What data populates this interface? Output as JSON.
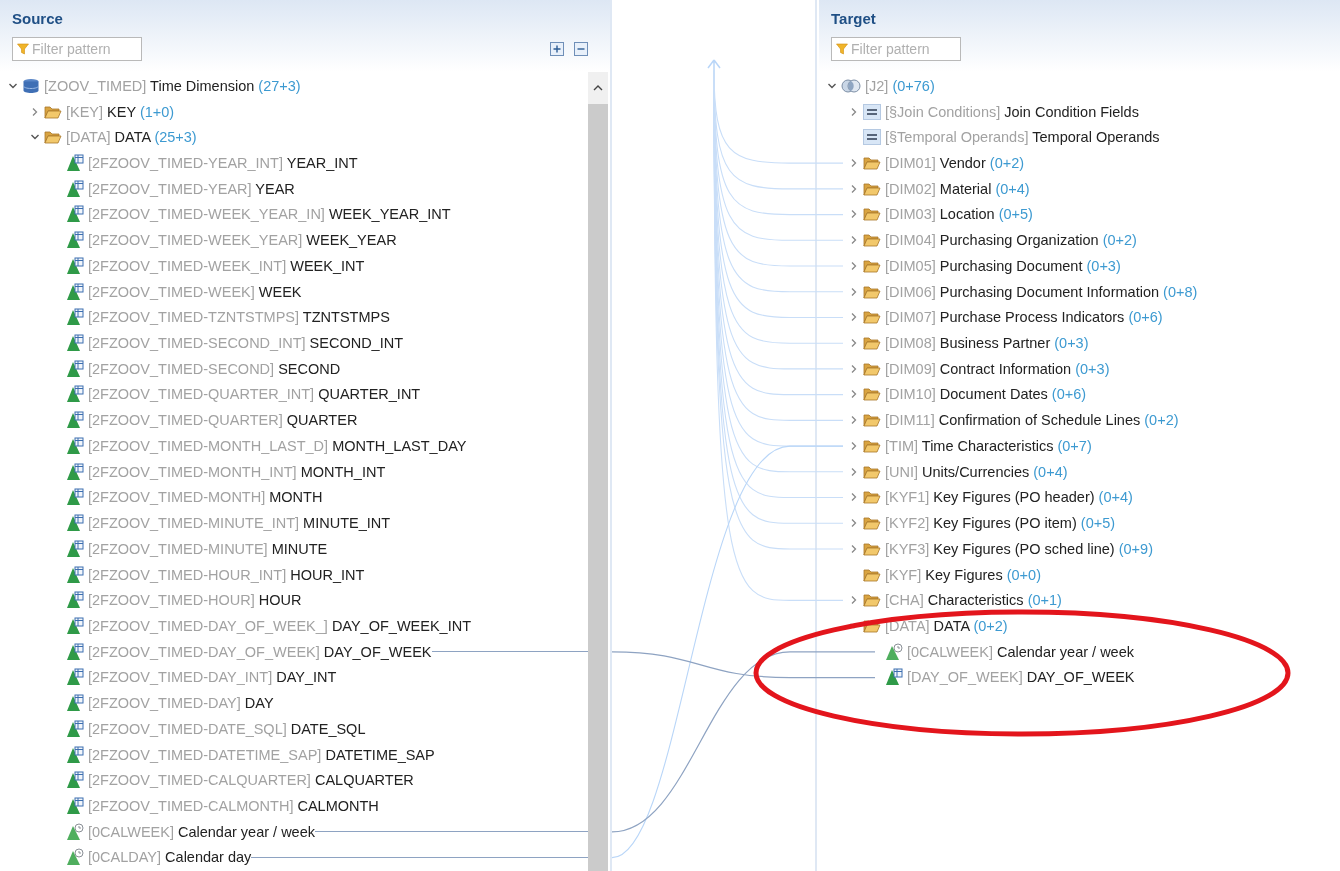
{
  "source": {
    "title": "Source",
    "filter": {
      "placeholder": "Filter pattern"
    },
    "tree": [
      {
        "kind": "table",
        "key": "[ZOOV_TIMED]",
        "name": "Time Dimension",
        "count": "(27+3)",
        "expanded": true,
        "children": [
          {
            "kind": "folder",
            "key": "[KEY]",
            "name": "KEY",
            "count": "(1+0)",
            "expanded": false
          },
          {
            "kind": "folder",
            "key": "[DATA]",
            "name": "DATA",
            "count": "(25+3)",
            "expanded": true,
            "children": [
              {
                "kind": "field",
                "key": "[2FZOOV_TIMED-YEAR_INT]",
                "name": "YEAR_INT",
                "mapped": false
              },
              {
                "kind": "field",
                "key": "[2FZOOV_TIMED-YEAR]",
                "name": "YEAR",
                "mapped": false
              },
              {
                "kind": "field",
                "key": "[2FZOOV_TIMED-WEEK_YEAR_IN]",
                "name": "WEEK_YEAR_INT",
                "mapped": false
              },
              {
                "kind": "field",
                "key": "[2FZOOV_TIMED-WEEK_YEAR]",
                "name": "WEEK_YEAR",
                "mapped": false
              },
              {
                "kind": "field",
                "key": "[2FZOOV_TIMED-WEEK_INT]",
                "name": "WEEK_INT",
                "mapped": false
              },
              {
                "kind": "field",
                "key": "[2FZOOV_TIMED-WEEK]",
                "name": "WEEK",
                "mapped": false
              },
              {
                "kind": "field",
                "key": "[2FZOOV_TIMED-TZNTSTMPS]",
                "name": "TZNTSTMPS",
                "mapped": false
              },
              {
                "kind": "field",
                "key": "[2FZOOV_TIMED-SECOND_INT]",
                "name": "SECOND_INT",
                "mapped": false
              },
              {
                "kind": "field",
                "key": "[2FZOOV_TIMED-SECOND]",
                "name": "SECOND",
                "mapped": false
              },
              {
                "kind": "field",
                "key": "[2FZOOV_TIMED-QUARTER_INT]",
                "name": "QUARTER_INT",
                "mapped": false
              },
              {
                "kind": "field",
                "key": "[2FZOOV_TIMED-QUARTER]",
                "name": "QUARTER",
                "mapped": false
              },
              {
                "kind": "field",
                "key": "[2FZOOV_TIMED-MONTH_LAST_D]",
                "name": "MONTH_LAST_DAY",
                "mapped": false
              },
              {
                "kind": "field",
                "key": "[2FZOOV_TIMED-MONTH_INT]",
                "name": "MONTH_INT",
                "mapped": false
              },
              {
                "kind": "field",
                "key": "[2FZOOV_TIMED-MONTH]",
                "name": "MONTH",
                "mapped": false
              },
              {
                "kind": "field",
                "key": "[2FZOOV_TIMED-MINUTE_INT]",
                "name": "MINUTE_INT",
                "mapped": false
              },
              {
                "kind": "field",
                "key": "[2FZOOV_TIMED-MINUTE]",
                "name": "MINUTE",
                "mapped": false
              },
              {
                "kind": "field",
                "key": "[2FZOOV_TIMED-HOUR_INT]",
                "name": "HOUR_INT",
                "mapped": false
              },
              {
                "kind": "field",
                "key": "[2FZOOV_TIMED-HOUR]",
                "name": "HOUR",
                "mapped": false
              },
              {
                "kind": "field",
                "key": "[2FZOOV_TIMED-DAY_OF_WEEK_]",
                "name": "DAY_OF_WEEK_INT",
                "mapped": false
              },
              {
                "kind": "field",
                "key": "[2FZOOV_TIMED-DAY_OF_WEEK]",
                "name": "DAY_OF_WEEK",
                "mapped": true
              },
              {
                "kind": "field",
                "key": "[2FZOOV_TIMED-DAY_INT]",
                "name": "DAY_INT",
                "mapped": false
              },
              {
                "kind": "field",
                "key": "[2FZOOV_TIMED-DAY]",
                "name": "DAY",
                "mapped": false
              },
              {
                "kind": "field",
                "key": "[2FZOOV_TIMED-DATE_SQL]",
                "name": "DATE_SQL",
                "mapped": false
              },
              {
                "kind": "field",
                "key": "[2FZOOV_TIMED-DATETIME_SAP]",
                "name": "DATETIME_SAP",
                "mapped": false
              },
              {
                "kind": "field",
                "key": "[2FZOOV_TIMED-CALQUARTER]",
                "name": "CALQUARTER",
                "mapped": false
              },
              {
                "kind": "field",
                "key": "[2FZOOV_TIMED-CALMONTH]",
                "name": "CALMONTH",
                "mapped": false
              },
              {
                "kind": "info-object",
                "key": "[0CALWEEK]",
                "name": "Calendar year / week",
                "mapped": true
              },
              {
                "kind": "info-object",
                "key": "[0CALDAY]",
                "name": "Calendar day",
                "mapped": true
              }
            ]
          }
        ]
      }
    ]
  },
  "target": {
    "title": "Target",
    "filter": {
      "placeholder": "Filter pattern"
    },
    "tree": [
      {
        "kind": "join",
        "key": "[J2]",
        "count": "(0+76)",
        "expanded": true,
        "children": [
          {
            "kind": "structure",
            "key": "[§Join Conditions]",
            "name": "Join Condition Fields",
            "expanded": false
          },
          {
            "kind": "structure",
            "key": "[§Temporal Operands]",
            "name": "Temporal Operands"
          },
          {
            "kind": "folder",
            "key": "[DIM01]",
            "name": "Vendor",
            "count": "(0+2)",
            "expanded": false
          },
          {
            "kind": "folder",
            "key": "[DIM02]",
            "name": "Material",
            "count": "(0+4)",
            "expanded": false
          },
          {
            "kind": "folder",
            "key": "[DIM03]",
            "name": "Location",
            "count": "(0+5)",
            "expanded": false
          },
          {
            "kind": "folder",
            "key": "[DIM04]",
            "name": "Purchasing Organization",
            "count": "(0+2)",
            "expanded": false
          },
          {
            "kind": "folder",
            "key": "[DIM05]",
            "name": "Purchasing Document",
            "count": "(0+3)",
            "expanded": false
          },
          {
            "kind": "folder",
            "key": "[DIM06]",
            "name": "Purchasing Document Information",
            "count": "(0+8)",
            "expanded": false
          },
          {
            "kind": "folder",
            "key": "[DIM07]",
            "name": "Purchase Process Indicators",
            "count": "(0+6)",
            "expanded": false
          },
          {
            "kind": "folder",
            "key": "[DIM08]",
            "name": "Business Partner",
            "count": "(0+3)",
            "expanded": false
          },
          {
            "kind": "folder",
            "key": "[DIM09]",
            "name": "Contract Information",
            "count": "(0+3)",
            "expanded": false
          },
          {
            "kind": "folder",
            "key": "[DIM10]",
            "name": "Document Dates",
            "count": "(0+6)",
            "expanded": false
          },
          {
            "kind": "folder",
            "key": "[DIM11]",
            "name": "Confirmation of Schedule Lines",
            "count": "(0+2)",
            "expanded": false
          },
          {
            "kind": "folder",
            "key": "[TIM]",
            "name": "Time Characteristics",
            "count": "(0+7)",
            "expanded": false
          },
          {
            "kind": "folder",
            "key": "[UNI]",
            "name": "Units/Currencies",
            "count": "(0+4)",
            "expanded": false
          },
          {
            "kind": "folder",
            "key": "[KYF1]",
            "name": "Key Figures (PO header)",
            "count": "(0+4)",
            "expanded": false
          },
          {
            "kind": "folder",
            "key": "[KYF2]",
            "name": "Key Figures (PO item)",
            "count": "(0+5)",
            "expanded": false
          },
          {
            "kind": "folder",
            "key": "[KYF3]",
            "name": "Key Figures (PO sched line)",
            "count": "(0+9)",
            "expanded": false
          },
          {
            "kind": "folder",
            "key": "[KYF]",
            "name": "Key Figures",
            "count": "(0+0)"
          },
          {
            "kind": "folder",
            "key": "[CHA]",
            "name": "Characteristics",
            "count": "(0+1)",
            "expanded": false
          },
          {
            "kind": "folder",
            "key": "[DATA]",
            "name": "DATA",
            "count": "(0+2)",
            "expanded": true,
            "children": [
              {
                "kind": "info-object",
                "key": "[0CALWEEK]",
                "name": "Calendar year / week"
              },
              {
                "kind": "field",
                "key": "[DAY_OF_WEEK]",
                "name": "DAY_OF_WEEK"
              }
            ]
          }
        ]
      }
    ]
  }
}
